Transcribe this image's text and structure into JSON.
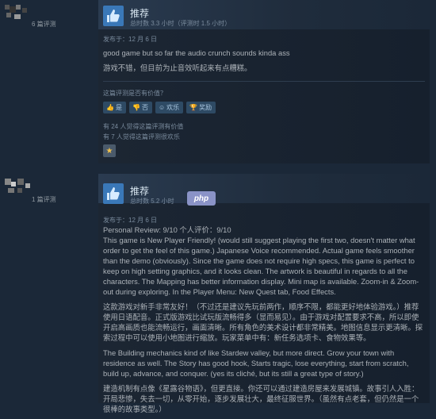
{
  "reviews": [
    {
      "review_count": "6 篇评测",
      "recommendation": "推荐",
      "hours": "总时数 3.3 小时（评测时 1.5 小时）",
      "posted": "发布于：12 月 6 日",
      "paragraphs": [
        "good game but so far the audio crunch sounds kinda ass",
        "游戏不错，但目前为止音效听起来有点糟糕。"
      ],
      "helpful_question": "这篇评测是否有价值？",
      "vote_buttons": [
        {
          "icon": "thumb-up-icon",
          "label": "是"
        },
        {
          "icon": "thumb-down-icon",
          "label": "否"
        },
        {
          "icon": "smile-icon",
          "label": "欢乐"
        },
        {
          "icon": "award-icon",
          "label": "奖励"
        }
      ],
      "stats": [
        "有 24 人觉得这篇评测有价值",
        "有 7 人觉得这篇评测很欢乐"
      ]
    },
    {
      "review_count": "1 篇评测",
      "recommendation": "推荐",
      "hours": "总时数 5.2 小时",
      "posted": "发布于：12 月 6 日",
      "paragraphs": [
        "Personal Review: 9/10 个人评价：9/10",
        "This game is New Player Friendly! (would still suggest playing the first two, doesn't matter what order to get the feel of this game.) Japanese Voice recommended. Actual game feels smoother than the demo (obviously). Since the game does not require high specs, this game is perfect to keep on high setting graphics, and it looks clean. The artwork is beautiful in regards to all the characters. The Mapping has better information display. Mini map is available. Zoom-in & Zoom-out during exploring. In the Player Menu: New Quest tab, Food Effects.",
        "这款游戏对新手非常友好！（不过还是建议先玩前两作，顺序不限，都能更好地体验游戏。）推荐使用日语配音。正式版游戏比试玩版流畅得多（显而易见）。由于游戏对配置要求不高，所以即使开启高画质也能流畅运行，画面清晰。所有角色的美术设计都非常精美。地图信息显示更清晰。探索过程中可以使用小地图进行缩放。玩家菜单中有：新任务选项卡、食物效果等。",
        "The Building mechanics kind of like Stardew valley, but more direct. Grow your town with residence as well. The Story has good hook, Starts tragic, lose everything, start from scratch, build up, advance, and conquer. (yes its cliché, but its still a great type of story.)",
        "建造机制有点像《星露谷物语》，但更直接。你还可以通过建造房屋来发展城镇。故事引人入胜：开局悲惨，失去一切，从零开始，逐步发展壮大，最终征服世界。（虽然有点老套，但仍然是一个很棒的故事类型。）"
      ]
    }
  ],
  "watermark": "php",
  "colors": {
    "background": "#1b2838",
    "thumb": "#3a78b8",
    "button": "#2e4a64"
  }
}
